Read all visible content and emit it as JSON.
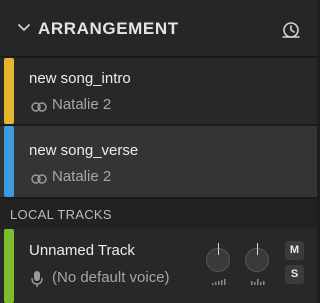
{
  "header": {
    "title": "ARRANGEMENT",
    "collapse_icon": "chevron-down-icon",
    "history_icon": "history-icon"
  },
  "tracks": [
    {
      "name": "new song_intro",
      "voice": "Natalie 2",
      "color": "#e5b431",
      "icon": "link-icon"
    },
    {
      "name": "new song_verse",
      "voice": "Natalie 2",
      "color": "#3c9be0",
      "icon": "link-icon"
    }
  ],
  "local_section": {
    "label": "LOCAL TRACKS"
  },
  "local_tracks": [
    {
      "name": "Unnamed Track",
      "voice": "(No default voice)",
      "color": "#7dbd2b",
      "icon": "microphone-icon",
      "mute_label": "M",
      "solo_label": "S"
    }
  ]
}
